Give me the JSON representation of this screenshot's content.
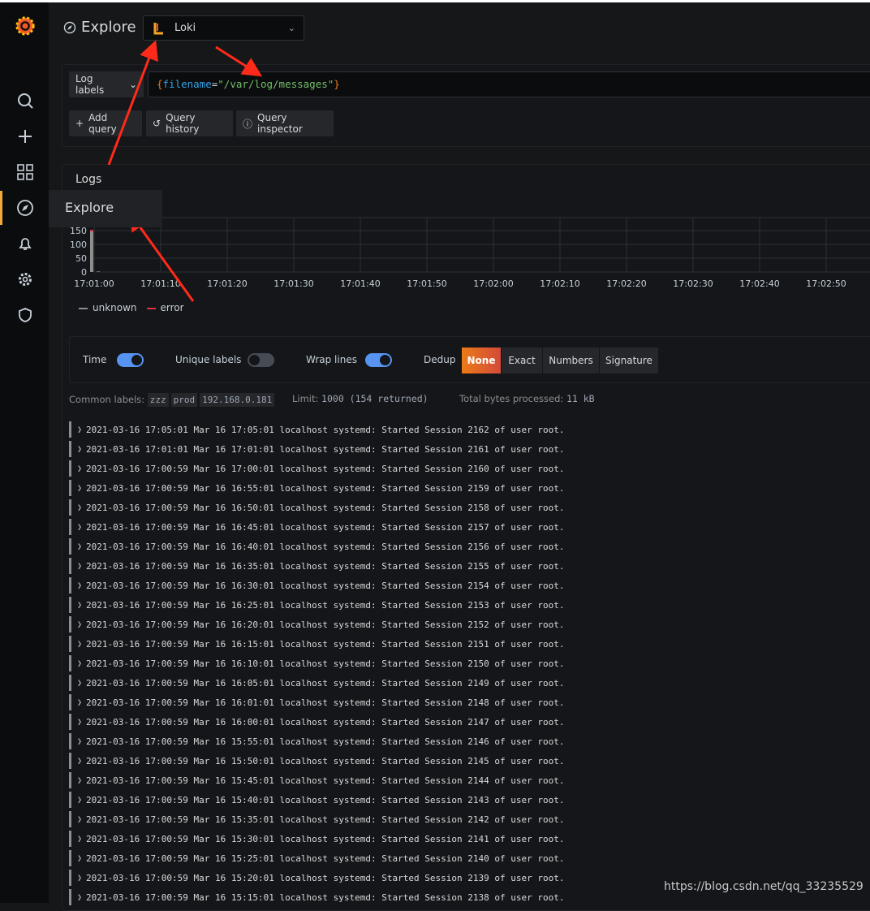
{
  "nav": {
    "items": [
      {
        "icon": "search-icon"
      },
      {
        "icon": "plus-icon"
      },
      {
        "icon": "dashboards-icon"
      },
      {
        "icon": "compass-icon",
        "active": true
      },
      {
        "icon": "bell-icon"
      },
      {
        "icon": "gear-icon"
      },
      {
        "icon": "shield-icon"
      }
    ],
    "tooltip": "Explore"
  },
  "header": {
    "title": "Explore",
    "datasource": "Loki"
  },
  "query": {
    "label_button": "Log labels",
    "expr_open": "{",
    "expr_key": "filename",
    "expr_eq": "=",
    "expr_value": "\"/var/log/messages\"",
    "expr_close": "}",
    "add_query": "Add query",
    "query_history": "Query history",
    "query_inspector": "Query inspector"
  },
  "logs": {
    "title": "Logs",
    "options": {
      "time_label": "Time",
      "time_on": true,
      "unique_label": "Unique labels",
      "unique_on": false,
      "wrap_label": "Wrap lines",
      "wrap_on": true,
      "dedup_label": "Dedup",
      "dedup": [
        "None",
        "Exact",
        "Numbers",
        "Signature"
      ],
      "dedup_selected": "None"
    },
    "common_labels_label": "Common labels:",
    "common_labels": [
      "zzz",
      "prod",
      "192.168.0.181"
    ],
    "limit_label": "Limit:",
    "limit_value": "1000 (154 returned)",
    "bytes_label": "Total bytes processed:",
    "bytes_value": "11 kB",
    "rows": [
      "2021-03-16 17:05:01 Mar 16 17:05:01 localhost systemd: Started Session 2162 of user root.",
      "2021-03-16 17:01:01 Mar 16 17:01:01 localhost systemd: Started Session 2161 of user root.",
      "2021-03-16 17:00:59 Mar 16 17:00:01 localhost systemd: Started Session 2160 of user root.",
      "2021-03-16 17:00:59 Mar 16 16:55:01 localhost systemd: Started Session 2159 of user root.",
      "2021-03-16 17:00:59 Mar 16 16:50:01 localhost systemd: Started Session 2158 of user root.",
      "2021-03-16 17:00:59 Mar 16 16:45:01 localhost systemd: Started Session 2157 of user root.",
      "2021-03-16 17:00:59 Mar 16 16:40:01 localhost systemd: Started Session 2156 of user root.",
      "2021-03-16 17:00:59 Mar 16 16:35:01 localhost systemd: Started Session 2155 of user root.",
      "2021-03-16 17:00:59 Mar 16 16:30:01 localhost systemd: Started Session 2154 of user root.",
      "2021-03-16 17:00:59 Mar 16 16:25:01 localhost systemd: Started Session 2153 of user root.",
      "2021-03-16 17:00:59 Mar 16 16:20:01 localhost systemd: Started Session 2152 of user root.",
      "2021-03-16 17:00:59 Mar 16 16:15:01 localhost systemd: Started Session 2151 of user root.",
      "2021-03-16 17:00:59 Mar 16 16:10:01 localhost systemd: Started Session 2150 of user root.",
      "2021-03-16 17:00:59 Mar 16 16:05:01 localhost systemd: Started Session 2149 of user root.",
      "2021-03-16 17:00:59 Mar 16 16:01:01 localhost systemd: Started Session 2148 of user root.",
      "2021-03-16 17:00:59 Mar 16 16:00:01 localhost systemd: Started Session 2147 of user root.",
      "2021-03-16 17:00:59 Mar 16 15:55:01 localhost systemd: Started Session 2146 of user root.",
      "2021-03-16 17:00:59 Mar 16 15:50:01 localhost systemd: Started Session 2145 of user root.",
      "2021-03-16 17:00:59 Mar 16 15:45:01 localhost systemd: Started Session 2144 of user root.",
      "2021-03-16 17:00:59 Mar 16 15:40:01 localhost systemd: Started Session 2143 of user root.",
      "2021-03-16 17:00:59 Mar 16 15:35:01 localhost systemd: Started Session 2142 of user root.",
      "2021-03-16 17:00:59 Mar 16 15:30:01 localhost systemd: Started Session 2141 of user root.",
      "2021-03-16 17:00:59 Mar 16 15:25:01 localhost systemd: Started Session 2140 of user root.",
      "2021-03-16 17:00:59 Mar 16 15:20:01 localhost systemd: Started Session 2139 of user root.",
      "2021-03-16 17:00:59 Mar 16 15:15:01 localhost systemd: Started Session 2138 of user root."
    ]
  },
  "chart_data": {
    "type": "bar",
    "x_ticks": [
      "17:01:00",
      "17:01:10",
      "17:01:20",
      "17:01:30",
      "17:01:40",
      "17:01:50",
      "17:02:00",
      "17:02:10",
      "17:02:20",
      "17:02:30",
      "17:02:40",
      "17:02:50"
    ],
    "y_ticks": [
      0,
      50,
      100,
      150
    ],
    "ylim": [
      0,
      150
    ],
    "grid": true,
    "legend_placement": "bottom-left",
    "series": [
      {
        "name": "unknown",
        "color": "#8e8e8e",
        "points": [
          {
            "x": "17:01:00",
            "y": 150
          },
          {
            "x": "17:01:01",
            "y": 2
          }
        ]
      },
      {
        "name": "error",
        "color": "#e02f44",
        "points": [
          {
            "x": "17:01:00",
            "y": 1
          }
        ]
      }
    ]
  },
  "watermark": "https://blog.csdn.net/qq_33235529",
  "colors": {
    "accent": "#f2a93b",
    "toggle_on": "#5794f2",
    "dedup_active": "#eb7b18",
    "annotation_arrow": "#ff2a1a"
  }
}
